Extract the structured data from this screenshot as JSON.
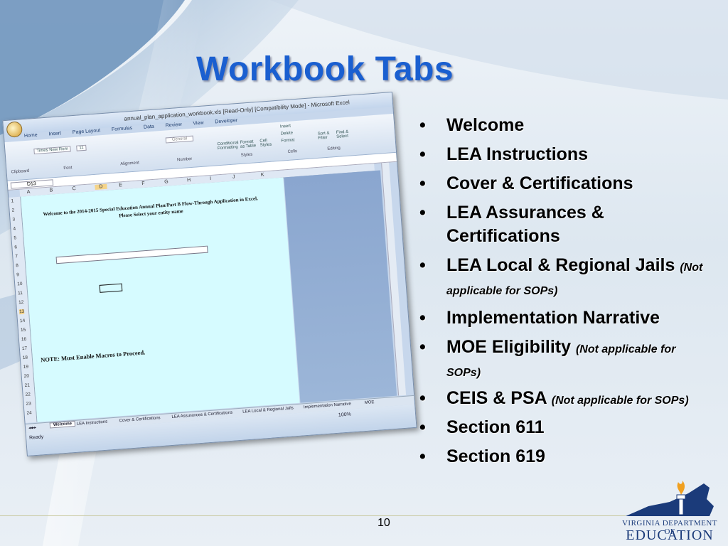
{
  "slide": {
    "title": "Workbook Tabs",
    "page_number": "10"
  },
  "bullets": [
    {
      "text": "Welcome",
      "note": ""
    },
    {
      "text": "LEA Instructions",
      "note": ""
    },
    {
      "text": "Cover & Certifications",
      "note": ""
    },
    {
      "text": "LEA Assurances & Certifications",
      "note": ""
    },
    {
      "text": "LEA Local & Regional Jails",
      "note": "(Not applicable for SOPs)"
    },
    {
      "text": "Implementation Narrative",
      "note": ""
    },
    {
      "text": "MOE Eligibility",
      "note": "(Not applicable for SOPs)"
    },
    {
      "text": "CEIS & PSA",
      "note": "(Not applicable for SOPs)"
    },
    {
      "text": "Section 611",
      "note": ""
    },
    {
      "text": "Section 619",
      "note": ""
    }
  ],
  "logo": {
    "line1": "VIRGINIA DEPARTMENT OF",
    "line2": "EDUCATION",
    "colors": {
      "navy": "#1b3b7a",
      "flame": "#f0a020"
    }
  },
  "excel": {
    "window_title": "annual_plan_application_workbook.xls [Read-Only] [Compatibility Mode] - Microsoft Excel",
    "ribbon_tabs": [
      "Home",
      "Insert",
      "Page Layout",
      "Formulas",
      "Data",
      "Review",
      "View",
      "Developer"
    ],
    "font_name": "Times New Rom",
    "font_size": "11",
    "number_format": "General",
    "group_labels": [
      "Clipboard",
      "Font",
      "Alignment",
      "Number",
      "Styles",
      "Cells",
      "Editing"
    ],
    "cell_buttons": [
      "Insert",
      "Delete",
      "Format"
    ],
    "style_buttons": [
      "Conditional Formatting",
      "Format as Table",
      "Cell Styles"
    ],
    "edit_buttons": [
      "Sort & Filter",
      "Find & Select"
    ],
    "name_box": "D13",
    "columns": [
      "A",
      "B",
      "C",
      "D",
      "E",
      "F",
      "G",
      "H",
      "I",
      "J",
      "K"
    ],
    "rows": [
      "1",
      "2",
      "3",
      "4",
      "5",
      "6",
      "7",
      "8",
      "9",
      "10",
      "11",
      "12",
      "13",
      "14",
      "15",
      "16",
      "17",
      "18",
      "19",
      "20",
      "21",
      "22",
      "23",
      "24"
    ],
    "welcome_line1": "Welcome to the 2014-2015 Special Education Annual Plan/Part B Flow-Through Application in Excel.",
    "welcome_line2": "Please Select your entity name",
    "note": "NOTE: Must Enable Macros to Proceed.",
    "sheet_tabs": [
      "Welcome",
      "LEA Instructions",
      "Cover & Certifications",
      "LEA Assurances & Certifications",
      "LEA Local & Regional Jails",
      "Implementation Narrative",
      "MOE"
    ],
    "status": "Ready",
    "zoom": "100%"
  }
}
